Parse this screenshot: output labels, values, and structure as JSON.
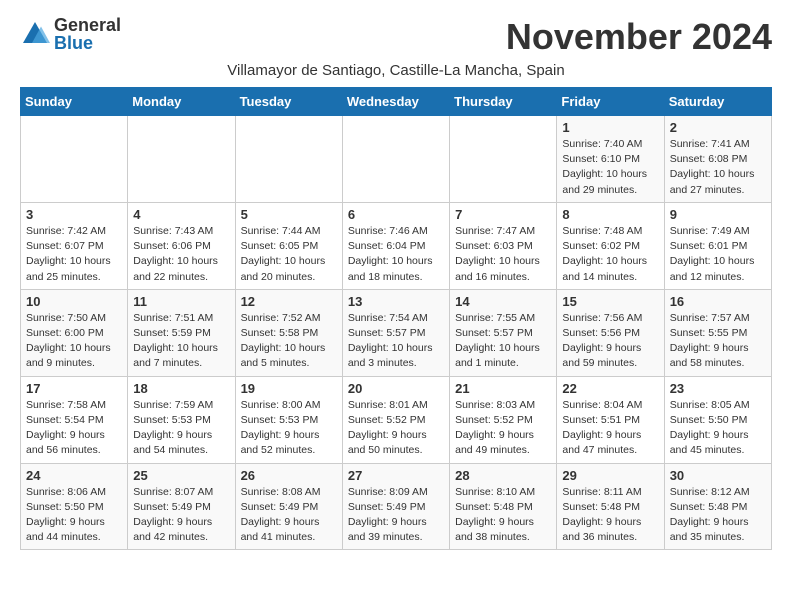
{
  "header": {
    "logo_general": "General",
    "logo_blue": "Blue",
    "month_title": "November 2024",
    "subtitle": "Villamayor de Santiago, Castille-La Mancha, Spain"
  },
  "days_of_week": [
    "Sunday",
    "Monday",
    "Tuesday",
    "Wednesday",
    "Thursday",
    "Friday",
    "Saturday"
  ],
  "weeks": [
    [
      {
        "day": "",
        "info": ""
      },
      {
        "day": "",
        "info": ""
      },
      {
        "day": "",
        "info": ""
      },
      {
        "day": "",
        "info": ""
      },
      {
        "day": "",
        "info": ""
      },
      {
        "day": "1",
        "info": "Sunrise: 7:40 AM\nSunset: 6:10 PM\nDaylight: 10 hours and 29 minutes."
      },
      {
        "day": "2",
        "info": "Sunrise: 7:41 AM\nSunset: 6:08 PM\nDaylight: 10 hours and 27 minutes."
      }
    ],
    [
      {
        "day": "3",
        "info": "Sunrise: 7:42 AM\nSunset: 6:07 PM\nDaylight: 10 hours and 25 minutes."
      },
      {
        "day": "4",
        "info": "Sunrise: 7:43 AM\nSunset: 6:06 PM\nDaylight: 10 hours and 22 minutes."
      },
      {
        "day": "5",
        "info": "Sunrise: 7:44 AM\nSunset: 6:05 PM\nDaylight: 10 hours and 20 minutes."
      },
      {
        "day": "6",
        "info": "Sunrise: 7:46 AM\nSunset: 6:04 PM\nDaylight: 10 hours and 18 minutes."
      },
      {
        "day": "7",
        "info": "Sunrise: 7:47 AM\nSunset: 6:03 PM\nDaylight: 10 hours and 16 minutes."
      },
      {
        "day": "8",
        "info": "Sunrise: 7:48 AM\nSunset: 6:02 PM\nDaylight: 10 hours and 14 minutes."
      },
      {
        "day": "9",
        "info": "Sunrise: 7:49 AM\nSunset: 6:01 PM\nDaylight: 10 hours and 12 minutes."
      }
    ],
    [
      {
        "day": "10",
        "info": "Sunrise: 7:50 AM\nSunset: 6:00 PM\nDaylight: 10 hours and 9 minutes."
      },
      {
        "day": "11",
        "info": "Sunrise: 7:51 AM\nSunset: 5:59 PM\nDaylight: 10 hours and 7 minutes."
      },
      {
        "day": "12",
        "info": "Sunrise: 7:52 AM\nSunset: 5:58 PM\nDaylight: 10 hours and 5 minutes."
      },
      {
        "day": "13",
        "info": "Sunrise: 7:54 AM\nSunset: 5:57 PM\nDaylight: 10 hours and 3 minutes."
      },
      {
        "day": "14",
        "info": "Sunrise: 7:55 AM\nSunset: 5:57 PM\nDaylight: 10 hours and 1 minute."
      },
      {
        "day": "15",
        "info": "Sunrise: 7:56 AM\nSunset: 5:56 PM\nDaylight: 9 hours and 59 minutes."
      },
      {
        "day": "16",
        "info": "Sunrise: 7:57 AM\nSunset: 5:55 PM\nDaylight: 9 hours and 58 minutes."
      }
    ],
    [
      {
        "day": "17",
        "info": "Sunrise: 7:58 AM\nSunset: 5:54 PM\nDaylight: 9 hours and 56 minutes."
      },
      {
        "day": "18",
        "info": "Sunrise: 7:59 AM\nSunset: 5:53 PM\nDaylight: 9 hours and 54 minutes."
      },
      {
        "day": "19",
        "info": "Sunrise: 8:00 AM\nSunset: 5:53 PM\nDaylight: 9 hours and 52 minutes."
      },
      {
        "day": "20",
        "info": "Sunrise: 8:01 AM\nSunset: 5:52 PM\nDaylight: 9 hours and 50 minutes."
      },
      {
        "day": "21",
        "info": "Sunrise: 8:03 AM\nSunset: 5:52 PM\nDaylight: 9 hours and 49 minutes."
      },
      {
        "day": "22",
        "info": "Sunrise: 8:04 AM\nSunset: 5:51 PM\nDaylight: 9 hours and 47 minutes."
      },
      {
        "day": "23",
        "info": "Sunrise: 8:05 AM\nSunset: 5:50 PM\nDaylight: 9 hours and 45 minutes."
      }
    ],
    [
      {
        "day": "24",
        "info": "Sunrise: 8:06 AM\nSunset: 5:50 PM\nDaylight: 9 hours and 44 minutes."
      },
      {
        "day": "25",
        "info": "Sunrise: 8:07 AM\nSunset: 5:49 PM\nDaylight: 9 hours and 42 minutes."
      },
      {
        "day": "26",
        "info": "Sunrise: 8:08 AM\nSunset: 5:49 PM\nDaylight: 9 hours and 41 minutes."
      },
      {
        "day": "27",
        "info": "Sunrise: 8:09 AM\nSunset: 5:49 PM\nDaylight: 9 hours and 39 minutes."
      },
      {
        "day": "28",
        "info": "Sunrise: 8:10 AM\nSunset: 5:48 PM\nDaylight: 9 hours and 38 minutes."
      },
      {
        "day": "29",
        "info": "Sunrise: 8:11 AM\nSunset: 5:48 PM\nDaylight: 9 hours and 36 minutes."
      },
      {
        "day": "30",
        "info": "Sunrise: 8:12 AM\nSunset: 5:48 PM\nDaylight: 9 hours and 35 minutes."
      }
    ]
  ]
}
